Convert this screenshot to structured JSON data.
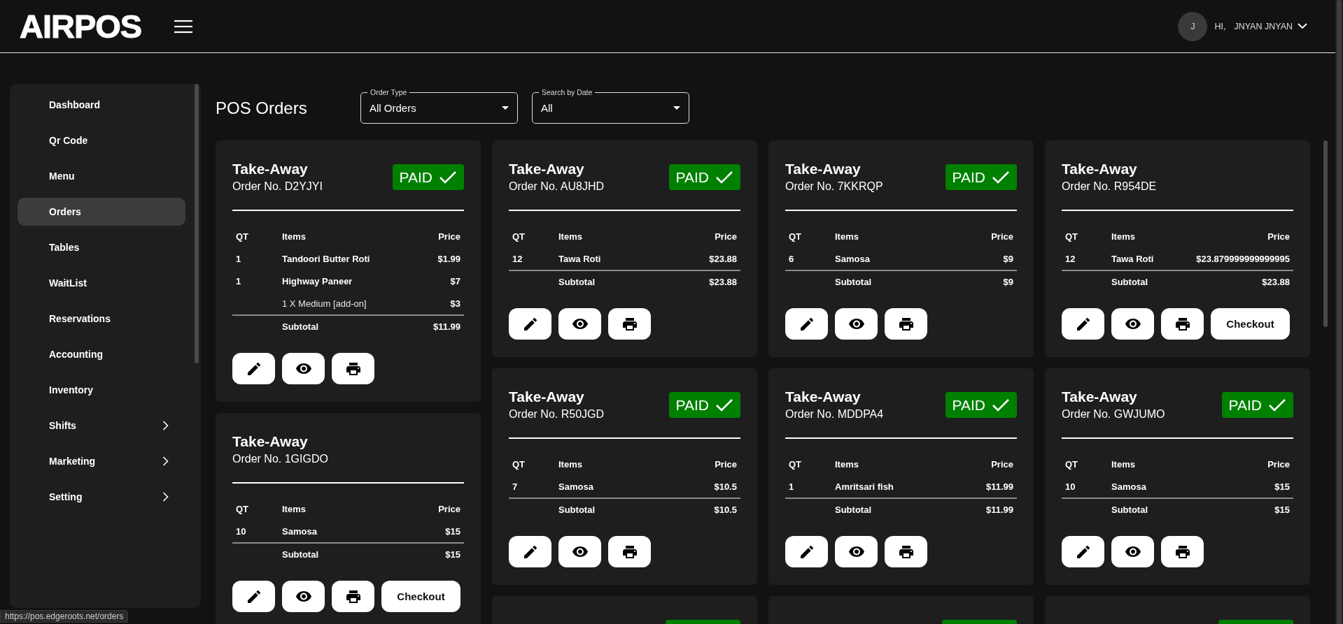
{
  "header": {
    "logo": "AIRPOS",
    "user": {
      "initial": "J",
      "greeting": "HI,",
      "name": "JNYAN JNYAN"
    }
  },
  "sidebar": {
    "items": [
      {
        "label": "Dashboard",
        "kind": "link",
        "selected": false
      },
      {
        "label": "Qr Code",
        "kind": "link",
        "selected": false
      },
      {
        "label": "Menu",
        "kind": "link",
        "selected": false
      },
      {
        "label": "Orders",
        "kind": "link",
        "selected": true
      },
      {
        "label": "Tables",
        "kind": "link",
        "selected": false
      },
      {
        "label": "WaitList",
        "kind": "link",
        "selected": false
      },
      {
        "label": "Reservations",
        "kind": "link",
        "selected": false
      },
      {
        "label": "Accounting",
        "kind": "link",
        "selected": false
      },
      {
        "label": "Inventory",
        "kind": "link",
        "selected": false
      },
      {
        "label": "Shifts",
        "kind": "group",
        "selected": false,
        "expanded": false
      },
      {
        "label": "Marketing",
        "kind": "group",
        "selected": false,
        "expanded": false
      },
      {
        "label": "Setting",
        "kind": "group",
        "selected": false,
        "expanded": false
      }
    ]
  },
  "page_title": "POS Orders",
  "filters": [
    {
      "label": "Order Type",
      "value": "All Orders"
    },
    {
      "label": "Search by Date",
      "value": "All"
    }
  ],
  "order_columns": [
    {
      "orders": [
        {
          "kind": "full",
          "type": "Take-Away",
          "order_no": "Order No. D2YJYI",
          "paid": true,
          "badge": "PAID",
          "columns": [
            "QT",
            "Items",
            "Price"
          ],
          "lines": [
            {
              "kind": "item",
              "qt": "1",
              "item": "Tandoori Butter Roti",
              "price": "$1.99"
            },
            {
              "kind": "item",
              "qt": "1",
              "item": "Highway Paneer",
              "price": "$7"
            },
            {
              "kind": "addon",
              "item": "1 X Medium [add-on]",
              "price": "$3"
            }
          ],
          "subtotal_label": "Subtotal",
          "subtotal": "$11.99",
          "actions": [
            {
              "kind": "edit"
            },
            {
              "kind": "view"
            },
            {
              "kind": "print"
            }
          ]
        },
        {
          "kind": "full",
          "type": "Take-Away",
          "order_no": "Order No. 1GIGDO",
          "paid": false,
          "columns": [
            "QT",
            "Items",
            "Price"
          ],
          "lines": [
            {
              "kind": "item",
              "qt": "10",
              "item": "Samosa",
              "price": "$15"
            }
          ],
          "subtotal_label": "Subtotal",
          "subtotal": "$15",
          "actions": [
            {
              "kind": "edit"
            },
            {
              "kind": "view"
            },
            {
              "kind": "print"
            },
            {
              "kind": "checkout",
              "label": "Checkout"
            }
          ]
        }
      ]
    },
    {
      "orders": [
        {
          "kind": "full",
          "type": "Take-Away",
          "order_no": "Order No. AU8JHD",
          "paid": true,
          "badge": "PAID",
          "columns": [
            "QT",
            "Items",
            "Price"
          ],
          "lines": [
            {
              "kind": "item",
              "qt": "12",
              "item": "Tawa Roti",
              "price": "$23.88"
            }
          ],
          "subtotal_label": "Subtotal",
          "subtotal": "$23.88",
          "actions": [
            {
              "kind": "edit"
            },
            {
              "kind": "view"
            },
            {
              "kind": "print"
            }
          ]
        },
        {
          "kind": "full",
          "type": "Take-Away",
          "order_no": "Order No. R50JGD",
          "paid": true,
          "badge": "PAID",
          "columns": [
            "QT",
            "Items",
            "Price"
          ],
          "lines": [
            {
              "kind": "item",
              "qt": "7",
              "item": "Samosa",
              "price": "$10.5"
            }
          ],
          "subtotal_label": "Subtotal",
          "subtotal": "$10.5",
          "actions": [
            {
              "kind": "edit"
            },
            {
              "kind": "view"
            },
            {
              "kind": "print"
            }
          ]
        },
        {
          "kind": "peek",
          "paid": true
        }
      ]
    },
    {
      "orders": [
        {
          "kind": "full",
          "type": "Take-Away",
          "order_no": "Order No. 7KKRQP",
          "paid": true,
          "badge": "PAID",
          "columns": [
            "QT",
            "Items",
            "Price"
          ],
          "lines": [
            {
              "kind": "item",
              "qt": "6",
              "item": "Samosa",
              "price": "$9"
            }
          ],
          "subtotal_label": "Subtotal",
          "subtotal": "$9",
          "actions": [
            {
              "kind": "edit"
            },
            {
              "kind": "view"
            },
            {
              "kind": "print"
            }
          ]
        },
        {
          "kind": "full",
          "type": "Take-Away",
          "order_no": "Order No. MDDPA4",
          "paid": true,
          "badge": "PAID",
          "columns": [
            "QT",
            "Items",
            "Price"
          ],
          "lines": [
            {
              "kind": "item",
              "qt": "1",
              "item": "Amritsari fish",
              "price": "$11.99"
            }
          ],
          "subtotal_label": "Subtotal",
          "subtotal": "$11.99",
          "actions": [
            {
              "kind": "edit"
            },
            {
              "kind": "view"
            },
            {
              "kind": "print"
            }
          ]
        },
        {
          "kind": "peek",
          "paid": true
        }
      ]
    },
    {
      "orders": [
        {
          "kind": "full",
          "type": "Take-Away",
          "order_no": "Order No. R954DE",
          "paid": false,
          "columns": [
            "QT",
            "Items",
            "Price"
          ],
          "lines": [
            {
              "kind": "item",
              "qt": "12",
              "item": "Tawa Roti",
              "price": "$23.879999999999995"
            }
          ],
          "subtotal_label": "Subtotal",
          "subtotal": "$23.88",
          "actions": [
            {
              "kind": "edit"
            },
            {
              "kind": "view"
            },
            {
              "kind": "print"
            },
            {
              "kind": "checkout",
              "label": "Checkout"
            }
          ]
        },
        {
          "kind": "full",
          "type": "Take-Away",
          "order_no": "Order No. GWJUMO",
          "paid": true,
          "badge": "PAID",
          "columns": [
            "QT",
            "Items",
            "Price"
          ],
          "lines": [
            {
              "kind": "item",
              "qt": "10",
              "item": "Samosa",
              "price": "$15"
            }
          ],
          "subtotal_label": "Subtotal",
          "subtotal": "$15",
          "actions": [
            {
              "kind": "edit"
            },
            {
              "kind": "view"
            },
            {
              "kind": "print"
            }
          ]
        },
        {
          "kind": "peek",
          "paid": true
        }
      ]
    }
  ],
  "status_url": "https://pos.edgeroots.net/orders"
}
